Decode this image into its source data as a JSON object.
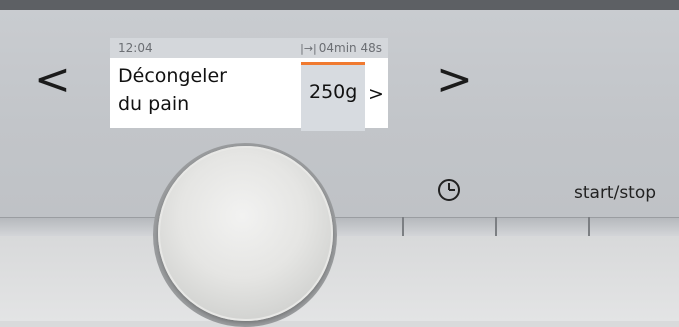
{
  "navigation": {
    "prev_symbol": "<",
    "next_symbol": ">"
  },
  "display": {
    "time": "12:04",
    "remaining_icon": "|→|",
    "remaining_time": "04min 48s",
    "program_line1": "Décongeler",
    "program_line2": "du pain",
    "weight": "250g",
    "weight_arrow": ">"
  },
  "controls": {
    "clock_icon": "clock-icon",
    "start_stop_label": "start/stop",
    "knob": "selector-knob"
  },
  "colors": {
    "accent": "#f07a30",
    "display_status_bg": "#d4d7db",
    "panel": "#c4c7cb"
  }
}
